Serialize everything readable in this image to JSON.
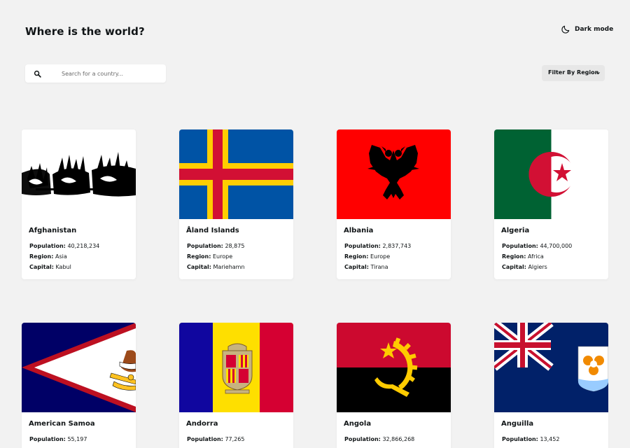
{
  "header": {
    "title": "Where is the world?",
    "theme_toggle_label": "Dark mode",
    "theme_icon": "moon-icon"
  },
  "search": {
    "placeholder": "Search for a country...",
    "value": "",
    "icon": "search-icon"
  },
  "filter": {
    "label": "Filter By Region",
    "icon": "chevron-down-icon"
  },
  "labels": {
    "population": "Population:",
    "region": "Region:",
    "capital": "Capital:"
  },
  "countries": [
    {
      "name": "Afghanistan",
      "population": "40,218,234",
      "region": "Asia",
      "capital": "Kabul",
      "flag": "afghanistan-flag"
    },
    {
      "name": "Åland Islands",
      "population": "28,875",
      "region": "Europe",
      "capital": "Mariehamn",
      "flag": "aland-flag"
    },
    {
      "name": "Albania",
      "population": "2,837,743",
      "region": "Europe",
      "capital": "Tirana",
      "flag": "albania-flag"
    },
    {
      "name": "Algeria",
      "population": "44,700,000",
      "region": "Africa",
      "capital": "Algiers",
      "flag": "algeria-flag"
    },
    {
      "name": "American Samoa",
      "population": "55,197",
      "flag": "american-samoa-flag"
    },
    {
      "name": "Andorra",
      "population": "77,265",
      "flag": "andorra-flag"
    },
    {
      "name": "Angola",
      "population": "32,866,268",
      "flag": "angola-flag"
    },
    {
      "name": "Anguilla",
      "population": "13,452",
      "flag": "anguilla-flag"
    }
  ],
  "colors": {
    "background": "#f2f2f2",
    "card": "#ffffff",
    "text": "#111517"
  }
}
